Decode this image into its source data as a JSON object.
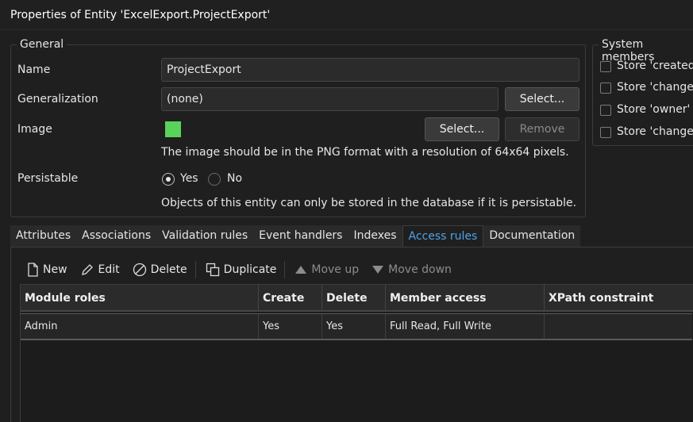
{
  "window": {
    "title": "Properties of Entity 'ExcelExport.ProjectExport'"
  },
  "general": {
    "legend": "General",
    "name_label": "Name",
    "name_value": "ProjectExport",
    "generalization_label": "Generalization",
    "generalization_value": "(none)",
    "generalization_select": "Select...",
    "image_label": "Image",
    "image_color": "#5ad35a",
    "image_select": "Select...",
    "image_remove": "Remove",
    "image_hint": "The image should be in the PNG format with a resolution of 64x64 pixels.",
    "persistable_label": "Persistable",
    "persistable_yes": "Yes",
    "persistable_no": "No",
    "persistable_selected": "Yes",
    "persistable_hint": "Objects of this entity can only be stored in the database if it is persistable."
  },
  "system_members": {
    "legend": "System members",
    "items": [
      {
        "label": "Store 'createdD",
        "checked": false
      },
      {
        "label": "Store 'changed",
        "checked": false
      },
      {
        "label": "Store 'owner'",
        "checked": false
      },
      {
        "label": "Store 'changed",
        "checked": false
      }
    ]
  },
  "tabs": [
    {
      "label": "Attributes",
      "active": false
    },
    {
      "label": "Associations",
      "active": false
    },
    {
      "label": "Validation rules",
      "active": false
    },
    {
      "label": "Event handlers",
      "active": false
    },
    {
      "label": "Indexes",
      "active": false
    },
    {
      "label": "Access rules",
      "active": true
    },
    {
      "label": "Documentation",
      "active": false
    }
  ],
  "toolbar": {
    "new": "New",
    "edit": "Edit",
    "delete": "Delete",
    "duplicate": "Duplicate",
    "move_up": "Move up",
    "move_down": "Move down"
  },
  "grid": {
    "columns": [
      "Module roles",
      "Create",
      "Delete",
      "Member access",
      "XPath constraint"
    ],
    "rows": [
      [
        "Admin",
        "Yes",
        "Yes",
        "Full Read, Full Write",
        ""
      ]
    ]
  },
  "colors": {
    "accent": "#4fa3e8",
    "background": "#1f1f1f"
  }
}
